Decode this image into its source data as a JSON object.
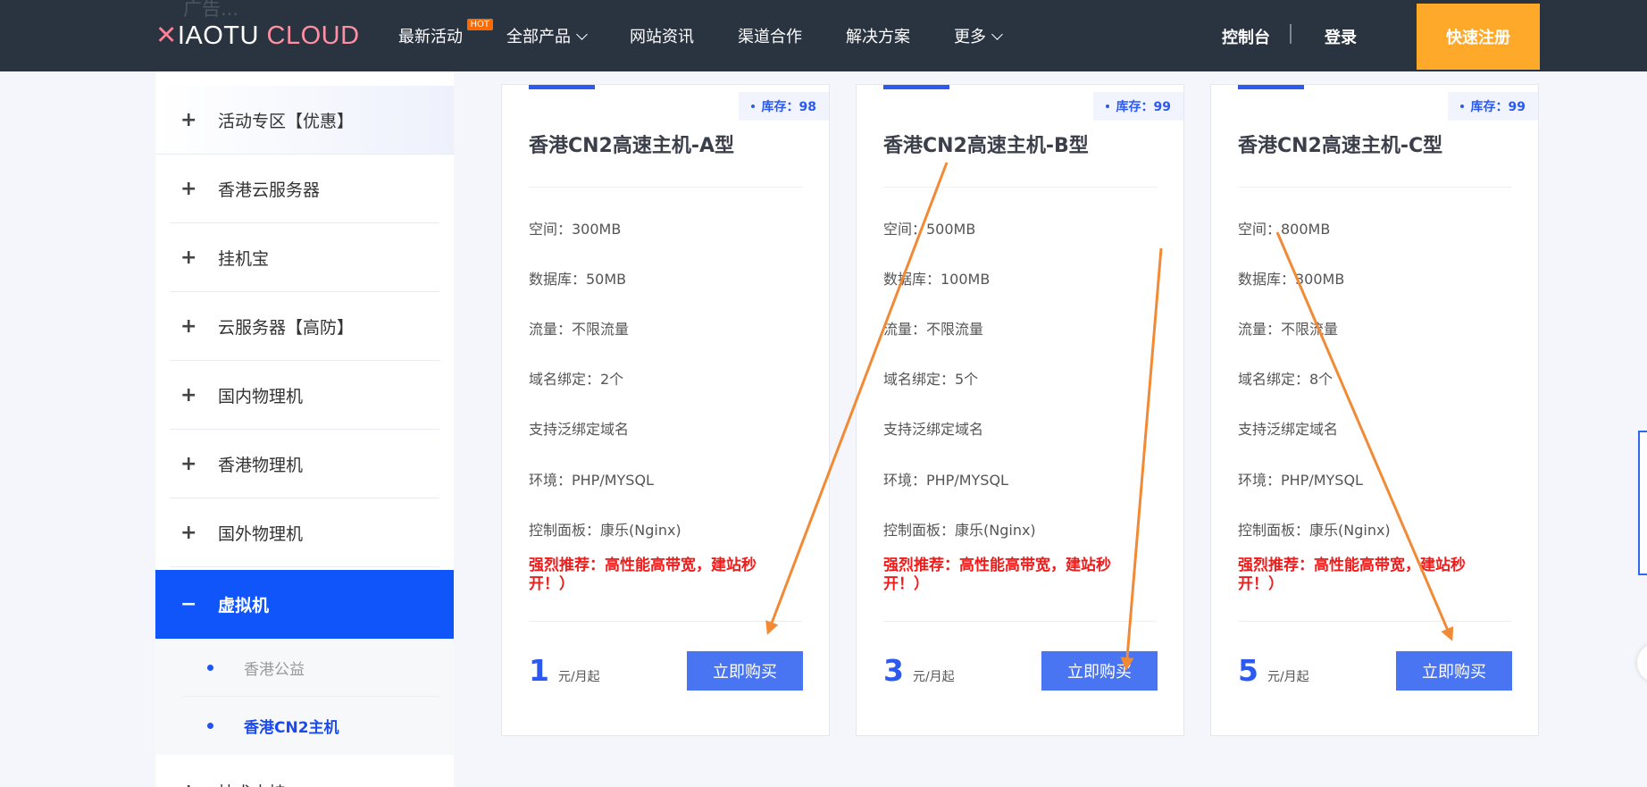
{
  "header": {
    "ghost_text": "广告...",
    "logo": {
      "x": "✕",
      "a": "IAOTU",
      "b": "CLOUD"
    },
    "nav": [
      {
        "label": "最新活动",
        "badge": "HOT",
        "dropdown": false
      },
      {
        "label": "全部产品",
        "dropdown": true
      },
      {
        "label": "网站资讯",
        "dropdown": false
      },
      {
        "label": "渠道合作",
        "dropdown": false
      },
      {
        "label": "解决方案",
        "dropdown": false
      },
      {
        "label": "更多",
        "dropdown": true
      }
    ],
    "console": "控制台",
    "login": "登录",
    "register": "快速注册"
  },
  "sidebar": {
    "categories": [
      {
        "icon": "+",
        "label": "活动专区【优惠】"
      },
      {
        "icon": "+",
        "label": "香港云服务器"
      },
      {
        "icon": "+",
        "label": "挂机宝"
      },
      {
        "icon": "+",
        "label": "云服务器【高防】"
      },
      {
        "icon": "+",
        "label": "国内物理机"
      },
      {
        "icon": "+",
        "label": "香港物理机"
      },
      {
        "icon": "+",
        "label": "国外物理机"
      },
      {
        "icon": "−",
        "label": "虚拟机"
      }
    ],
    "subitems": [
      {
        "label": "香港公益"
      },
      {
        "label": "香港CN2主机"
      }
    ],
    "tail": {
      "icon": "+",
      "label": "技术支持"
    }
  },
  "cards": [
    {
      "stock": "库存：98",
      "title": "香港CN2高速主机-A型",
      "specs": [
        "空间：300MB",
        "数据库：50MB",
        "流量：不限流量",
        "域名绑定：2个",
        "支持泛绑定域名",
        "环境：PHP/MYSQL",
        "控制面板：康乐(Nginx)"
      ],
      "recommend": "强烈推荐：高性能高带宽，建站秒开！）",
      "price": "1",
      "unit": "元/月起",
      "buy": "立即购买"
    },
    {
      "stock": "库存：99",
      "title": "香港CN2高速主机-B型",
      "specs": [
        "空间：500MB",
        "数据库：100MB",
        "流量：不限流量",
        "域名绑定：5个",
        "支持泛绑定域名",
        "环境：PHP/MYSQL",
        "控制面板：康乐(Nginx)"
      ],
      "recommend": "强烈推荐：高性能高带宽，建站秒开！）",
      "price": "3",
      "unit": "元/月起",
      "buy": "立即购买"
    },
    {
      "stock": "库存：99",
      "title": "香港CN2高速主机-C型",
      "specs": [
        "空间：800MB",
        "数据库：300MB",
        "流量：不限流量",
        "域名绑定：8个",
        "支持泛绑定域名",
        "环境：PHP/MYSQL",
        "控制面板：康乐(Nginx)"
      ],
      "recommend": "强烈推荐：高性能高带宽，建站秒开！）",
      "price": "5",
      "unit": "元/月起",
      "buy": "立即购买"
    }
  ],
  "annotation_color": "#f28a35"
}
